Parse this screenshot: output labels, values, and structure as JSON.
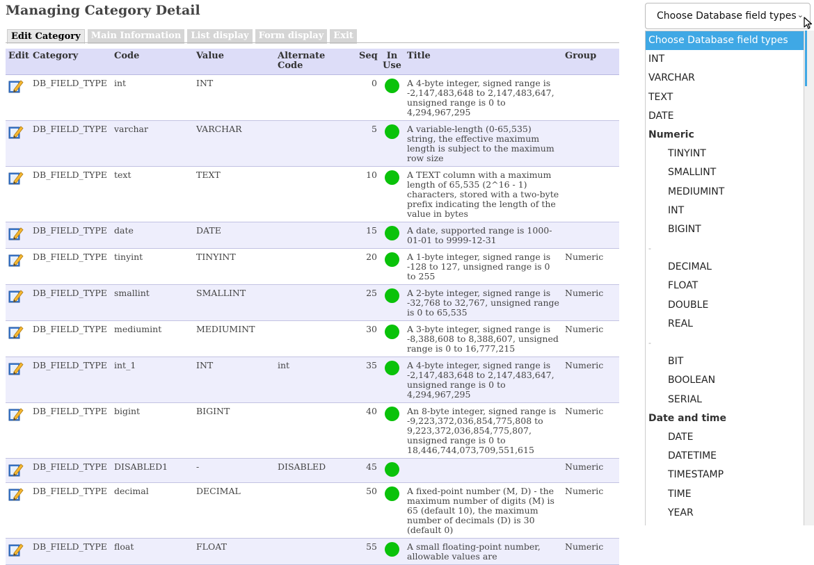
{
  "page": {
    "title": "Managing Category Detail"
  },
  "tabs": [
    {
      "label": "Edit Category",
      "active": true
    },
    {
      "label": "Main Information",
      "active": false
    },
    {
      "label": "List display",
      "active": false
    },
    {
      "label": "Form display",
      "active": false
    },
    {
      "label": "Exit",
      "active": false
    }
  ],
  "table": {
    "headers": {
      "edit": "Edit",
      "category": "Category",
      "code": "Code",
      "value": "Value",
      "alt": "Alternate Code",
      "seq": "Seq",
      "inuse": "In Use",
      "title": "Title",
      "group": "Group"
    },
    "rows": [
      {
        "category": "DB_FIELD_TYPE",
        "code": "int",
        "value": "INT",
        "alt": "",
        "seq": "0",
        "title": "A 4-byte integer, signed range is -2,147,483,648 to 2,147,483,647, unsigned range is 0 to 4,294,967,295",
        "group": ""
      },
      {
        "category": "DB_FIELD_TYPE",
        "code": "varchar",
        "value": "VARCHAR",
        "alt": "",
        "seq": "5",
        "title": "A variable-length (0-65,535) string, the effective maximum length is subject to the maximum row size",
        "group": ""
      },
      {
        "category": "DB_FIELD_TYPE",
        "code": "text",
        "value": "TEXT",
        "alt": "",
        "seq": "10",
        "title": "A TEXT column with a maximum length of 65,535 (2^16 - 1) characters, stored with a two-byte prefix indicating the length of the value in bytes",
        "group": ""
      },
      {
        "category": "DB_FIELD_TYPE",
        "code": "date",
        "value": "DATE",
        "alt": "",
        "seq": "15",
        "title": "A date, supported range is 1000-01-01 to 9999-12-31",
        "group": ""
      },
      {
        "category": "DB_FIELD_TYPE",
        "code": "tinyint",
        "value": "TINYINT",
        "alt": "",
        "seq": "20",
        "title": "A 1-byte integer, signed range is -128 to 127, unsigned range is 0 to 255",
        "group": "Numeric"
      },
      {
        "category": "DB_FIELD_TYPE",
        "code": "smallint",
        "value": "SMALLINT",
        "alt": "",
        "seq": "25",
        "title": "A 2-byte integer, signed range is -32,768 to 32,767, unsigned range is 0 to 65,535",
        "group": "Numeric"
      },
      {
        "category": "DB_FIELD_TYPE",
        "code": "mediumint",
        "value": "MEDIUMINT",
        "alt": "",
        "seq": "30",
        "title": "A 3-byte integer, signed range is -8,388,608 to 8,388,607, unsigned range is 0 to 16,777,215",
        "group": "Numeric"
      },
      {
        "category": "DB_FIELD_TYPE",
        "code": "int_1",
        "value": "INT",
        "alt": "int",
        "seq": "35",
        "title": "A 4-byte integer, signed range is -2,147,483,648 to 2,147,483,647, unsigned range is 0 to 4,294,967,295",
        "group": "Numeric"
      },
      {
        "category": "DB_FIELD_TYPE",
        "code": "bigint",
        "value": "BIGINT",
        "alt": "",
        "seq": "40",
        "title": "An 8-byte integer, signed range is -9,223,372,036,854,775,808 to 9,223,372,036,854,775,807, unsigned range is 0 to 18,446,744,073,709,551,615",
        "group": "Numeric"
      },
      {
        "category": "DB_FIELD_TYPE",
        "code": "DISABLED1",
        "value": "-",
        "alt": "DISABLED",
        "seq": "45",
        "title": "",
        "group": "Numeric"
      },
      {
        "category": "DB_FIELD_TYPE",
        "code": "decimal",
        "value": "DECIMAL",
        "alt": "",
        "seq": "50",
        "title": "A fixed-point number (M, D) - the maximum number of digits (M) is 65 (default 10), the maximum number of decimals (D) is 30 (default 0)",
        "group": "Numeric"
      },
      {
        "category": "DB_FIELD_TYPE",
        "code": "float",
        "value": "FLOAT",
        "alt": "",
        "seq": "55",
        "title": "A small floating-point number, allowable values are",
        "group": "Numeric"
      }
    ]
  },
  "select": {
    "value": "Choose Database field types",
    "options": [
      {
        "label": "Choose Database field types",
        "kind": "selected"
      },
      {
        "label": "INT",
        "kind": "item"
      },
      {
        "label": "VARCHAR",
        "kind": "item"
      },
      {
        "label": "TEXT",
        "kind": "item"
      },
      {
        "label": "DATE",
        "kind": "item"
      },
      {
        "label": "Numeric",
        "kind": "group"
      },
      {
        "label": "TINYINT",
        "kind": "sub"
      },
      {
        "label": "SMALLINT",
        "kind": "sub"
      },
      {
        "label": "MEDIUMINT",
        "kind": "sub"
      },
      {
        "label": "INT",
        "kind": "sub"
      },
      {
        "label": "BIGINT",
        "kind": "sub"
      },
      {
        "label": "-",
        "kind": "sep"
      },
      {
        "label": "DECIMAL",
        "kind": "sub"
      },
      {
        "label": "FLOAT",
        "kind": "sub"
      },
      {
        "label": "DOUBLE",
        "kind": "sub"
      },
      {
        "label": "REAL",
        "kind": "sub"
      },
      {
        "label": "-",
        "kind": "sep"
      },
      {
        "label": "BIT",
        "kind": "sub"
      },
      {
        "label": "BOOLEAN",
        "kind": "sub"
      },
      {
        "label": "SERIAL",
        "kind": "sub"
      },
      {
        "label": "Date and time",
        "kind": "group"
      },
      {
        "label": "DATE",
        "kind": "sub"
      },
      {
        "label": "DATETIME",
        "kind": "sub"
      },
      {
        "label": "TIMESTAMP",
        "kind": "sub"
      },
      {
        "label": "TIME",
        "kind": "sub"
      },
      {
        "label": "YEAR",
        "kind": "sub"
      }
    ]
  },
  "icons": {
    "edit": "pencil-edit-icon",
    "inuse": "in-use-dot-icon",
    "chevron": "chevron-down-icon",
    "cursor": "mouse-pointer-icon"
  },
  "colors": {
    "header_bg": "#ddddf8",
    "alt_row": "#eeeefc",
    "in_use": "#0ac20a",
    "option_selected": "#3fa8e5"
  }
}
